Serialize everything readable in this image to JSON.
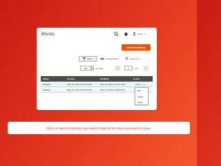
{
  "header": {
    "title": "Blocks",
    "user": "admin",
    "icons": [
      "search-icon",
      "bell-icon",
      "user-icon"
    ]
  },
  "actions": {
    "add_button": "Add New Block"
  },
  "toolbar": {
    "filters_label": "Filters",
    "view_label": "Default View",
    "columns_label": "Columns",
    "per_page_value": "20",
    "per_page_label": "per page",
    "page_value": "1",
    "page_of": "of 1"
  },
  "grid": {
    "columns": [
      "Status",
      "Created",
      "Modified",
      "Action"
    ],
    "rows": [
      {
        "status": "Enabled",
        "created": "May 24, 2019 11:47:51 AM",
        "modified": "May 24, 2019 11:47:51 AM",
        "action": "Select"
      },
      {
        "status": "Enabled",
        "created": "May 24, 2019 11:50:23 AM",
        "modified": "May 24, 2019 11:50:23 AM",
        "action": "Select"
      }
    ]
  },
  "dropdown": {
    "items": [
      "Edit",
      "Delete",
      "Clone"
    ]
  },
  "caption": "Click on Select dropdown and select  Clone for the block you want to clone.",
  "colors": {
    "accent": "#eb5202",
    "header_bg": "#514943",
    "link": "#007bdb",
    "caption_text": "#e02a1a"
  }
}
